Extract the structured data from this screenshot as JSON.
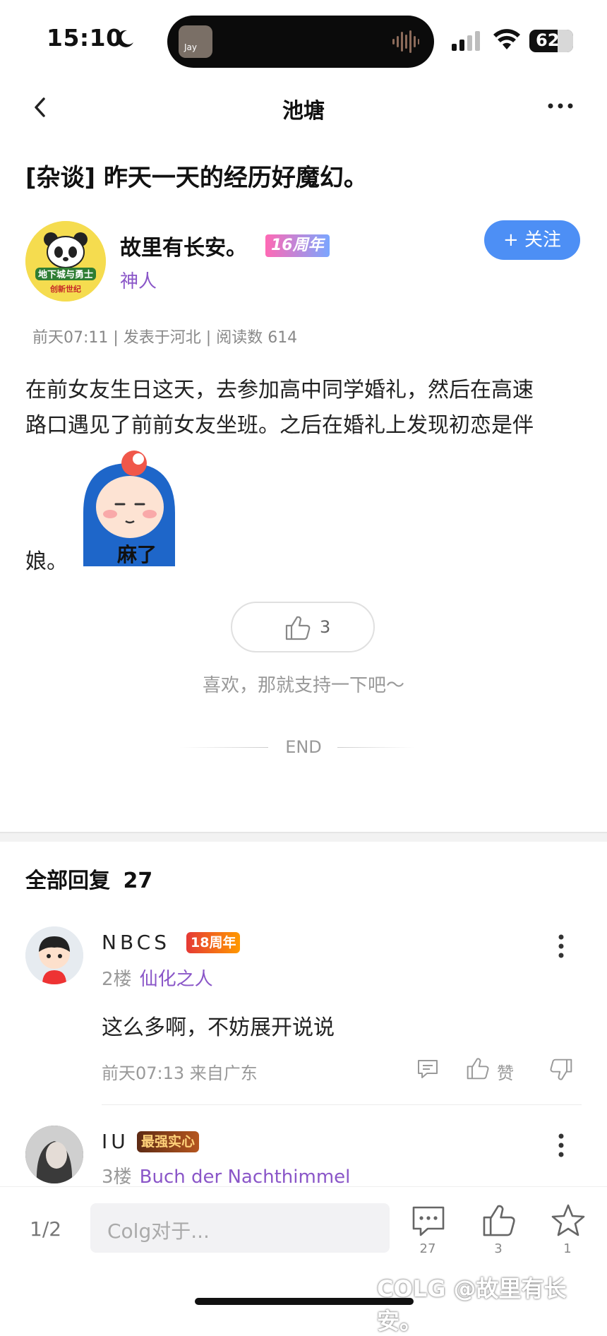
{
  "status_bar": {
    "time": "15:10",
    "battery": "62",
    "island_label": "Jay"
  },
  "nav": {
    "title": "池塘"
  },
  "post": {
    "title": "[杂谈] 昨天一天的经历好魔幻。",
    "author": {
      "name": "故里有长安。",
      "badge": "16周年",
      "rank": "神人",
      "avatar_text": "地下城与勇士 创新世纪",
      "follow_label": "+ 关注"
    },
    "meta": "前天07:11 | 发表于河北 | 阅读数 614",
    "body_line1": "在前女友生日这天，去参加高中同学婚礼，然后在高速",
    "body_line2": "路口遇见了前前女友坐班。之后在婚礼上发现初恋是伴",
    "body_end": "娘。",
    "sticker_text": "麻了",
    "likes": "3",
    "support_text": "喜欢，那就支持一下吧～",
    "end_text": "END"
  },
  "replies": {
    "heading": "全部回复",
    "count": "27",
    "items": [
      {
        "name": "NBCS",
        "badge": "18周年",
        "floor": "2楼",
        "rank": "仙化之人",
        "text": "这么多啊，不妨展开说说",
        "meta": "前天07:13 来自广东",
        "like_label": "赞"
      },
      {
        "name": "IU",
        "badge": "最强实心",
        "floor": "3楼",
        "rank": "Buch der Nachthimmel"
      }
    ]
  },
  "bottom_bar": {
    "page": "1/2",
    "input_placeholder": "Colg对于...",
    "comments_count": "27",
    "likes_count": "3",
    "favorites_count": "1"
  },
  "watermark": "COLG @故里有长安。",
  "colors": {
    "accent": "#4d8ff5",
    "rank_purple": "#8a56c8"
  }
}
